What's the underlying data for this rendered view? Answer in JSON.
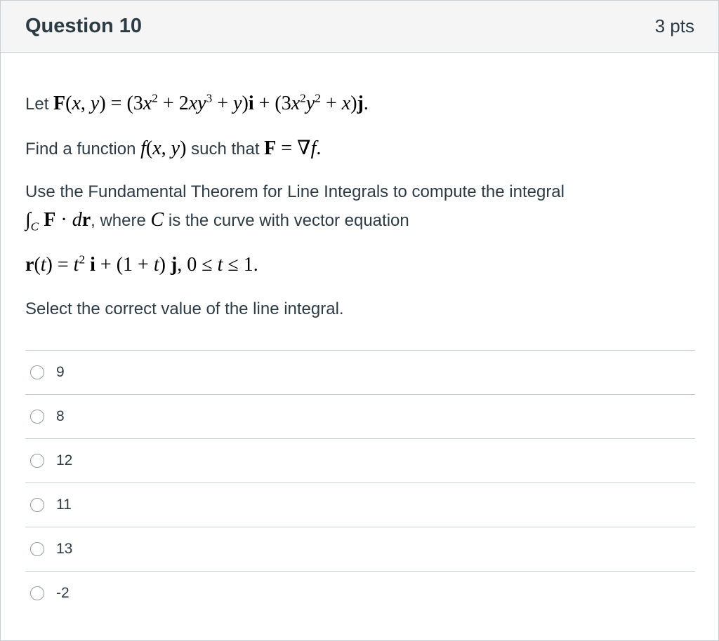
{
  "header": {
    "title": "Question 10",
    "points": "3 pts"
  },
  "question": {
    "line1_prefix": "Let ",
    "line2_prefix": "Find a function ",
    "line2_mid": " such that ",
    "line3": "Use the Fundamental Theorem for Line Integrals to compute the integral",
    "line4_mid": ", where ",
    "line4_suffix": " is the curve with vector equation",
    "line6": "Select the correct value of the line integral."
  },
  "answers": [
    "9",
    "8",
    "12",
    "11",
    "13",
    "-2"
  ]
}
